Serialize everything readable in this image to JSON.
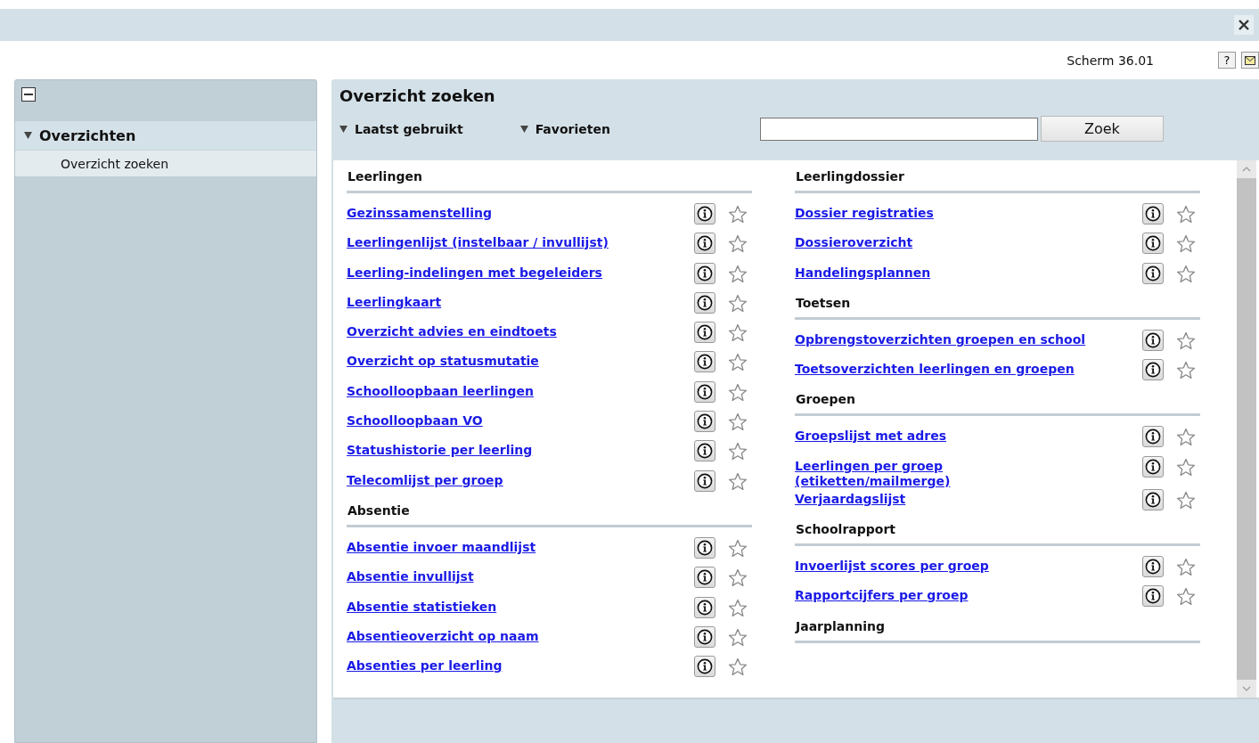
{
  "screen_code": "Scherm 36.01",
  "top_icons": [
    {
      "kind": "help",
      "label": "?"
    },
    {
      "kind": "mail"
    }
  ],
  "sidebar": {
    "groups": [
      {
        "label": "Overzichten",
        "expanded": true,
        "children": [
          {
            "label": "Overzicht zoeken",
            "selected": true
          }
        ]
      }
    ]
  },
  "panel": {
    "title": "Overzicht zoeken",
    "dropdowns": [
      {
        "label": "Laatst gebruikt"
      },
      {
        "label": "Favorieten"
      }
    ],
    "search": {
      "button": "Zoek"
    },
    "columns": [
      {
        "sections": [
          {
            "title": "Leerlingen",
            "items": [
              {
                "label": "Gezinssamenstelling"
              },
              {
                "label": "Leerlingenlijst (instelbaar / invullijst)"
              },
              {
                "label": "Leerling-indelingen met begeleiders"
              },
              {
                "label": "Leerlingkaart"
              },
              {
                "label": "Overzicht advies en eindtoets"
              },
              {
                "label": "Overzicht op statusmutatie"
              },
              {
                "label": "Schoolloopbaan leerlingen"
              },
              {
                "label": "Schoolloopbaan VO"
              },
              {
                "label": "Statushistorie per leerling"
              },
              {
                "label": "Telecomlijst per groep"
              }
            ]
          },
          {
            "title": "Absentie",
            "items": [
              {
                "label": "Absentie invoer maandlijst"
              },
              {
                "label": "Absentie invullijst"
              },
              {
                "label": "Absentie statistieken"
              },
              {
                "label": "Absentieoverzicht op naam"
              },
              {
                "label": "Absenties per leerling"
              }
            ]
          }
        ]
      },
      {
        "sections": [
          {
            "title": "Leerlingdossier",
            "items": [
              {
                "label": "Dossier registraties"
              },
              {
                "label": "Dossieroverzicht"
              },
              {
                "label": "Handelingsplannen"
              }
            ]
          },
          {
            "title": "Toetsen",
            "items": [
              {
                "label": "Opbrengstoverzichten groepen en school"
              },
              {
                "label": "Toetsoverzichten leerlingen en groepen"
              }
            ]
          },
          {
            "title": "Groepen",
            "items": [
              {
                "label": "Groepslijst met adres"
              },
              {
                "label": "Leerlingen per groep (etiketten/mailmerge)"
              },
              {
                "label": "Verjaardagslijst"
              }
            ]
          },
          {
            "title": "Schoolrapport",
            "items": [
              {
                "label": "Invoerlijst scores per groep"
              },
              {
                "label": "Rapportcijfers per groep"
              }
            ]
          },
          {
            "title": "Jaarplanning"
          }
        ]
      }
    ]
  }
}
